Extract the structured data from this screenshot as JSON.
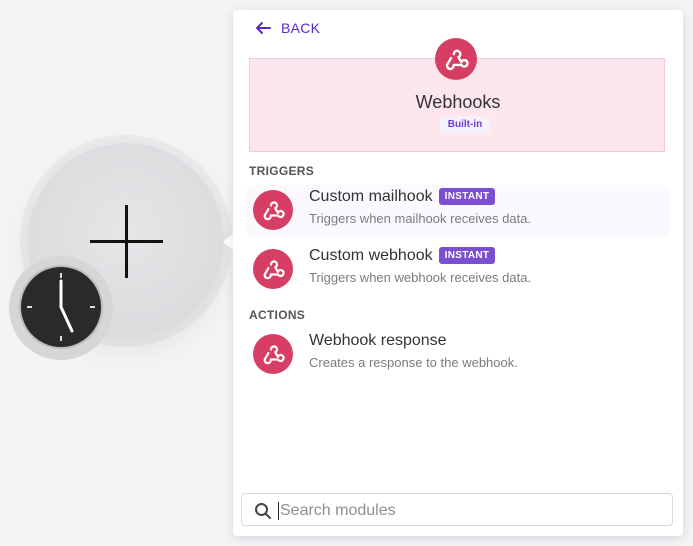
{
  "panel": {
    "back_label": "BACK",
    "app": {
      "title": "Webhooks",
      "badge": "Built-in",
      "icon": "webhook-icon",
      "color": "#d63e63"
    },
    "triggers_title": "TRIGGERS",
    "actions_title": "ACTIONS",
    "modules": [
      {
        "name": "Custom mailhook",
        "badge": "INSTANT",
        "desc": "Triggers when mailhook receives data."
      },
      {
        "name": "Custom webhook",
        "badge": "INSTANT",
        "desc": "Triggers when webhook receives data."
      },
      {
        "name": "Webhook response",
        "desc": "Creates a response to the webhook."
      }
    ],
    "search": {
      "placeholder": "Search modules"
    }
  },
  "colors": {
    "accent": "#5b2bbf",
    "instant": "#7b4fd1",
    "webhook": "#d63e63",
    "hero_bg": "#fde7ec"
  }
}
